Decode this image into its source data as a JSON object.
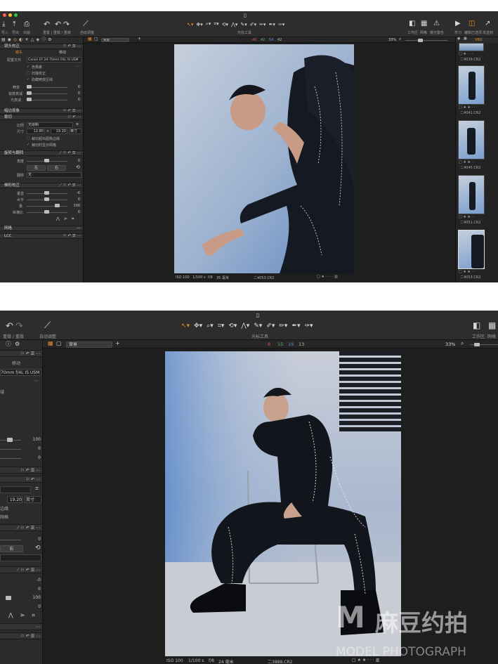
{
  "top": {
    "toolbar": {
      "import_label": "导入",
      "export_label": "导出",
      "output_label": "出版",
      "undo_redo_label": "重置 | 重做 / 重做",
      "auto_adjust_label": "自动调整",
      "cursor_tools_label": "光标工具",
      "layout_label": "工作区",
      "grid_label": "网格",
      "warning_label": "曝光警告",
      "learn_label": "学习",
      "edit_label": "编辑已选项",
      "send_label": "发送到"
    },
    "viewer_bar": {
      "layer_select": "背景",
      "counts": [
        "40",
        "42",
        "54",
        "42"
      ],
      "zoom": "33%"
    },
    "lens": {
      "header": "镜头校正",
      "tab_lens": "镜头",
      "tab_move": "移动",
      "profile_label": "配置文件",
      "profile_value": "Canon EF 24-70mm f/4L IS USM",
      "opt_chromatic": "色像差",
      "opt_purple": "扫描校正",
      "opt_hide": "隐藏畸变区域",
      "distortion_label": "畸变",
      "sharpness_label": "锐度衰减",
      "light_label": "光衰减",
      "distortion_value": "0",
      "sharpness_value": "0",
      "light_value": "0"
    },
    "vignette_header": "暗边现象",
    "crop": {
      "header": "裁切",
      "ratio_label": "比例",
      "ratio_value": "无限制",
      "size_label": "尺寸",
      "width": "12.80",
      "height": "19.20",
      "unit": "英寸",
      "opt_outside": "裁切超出图像边缘",
      "opt_grid": "裁切时显示网格"
    },
    "rotate": {
      "header": "旋转与翻转",
      "angle_label": "角度",
      "angle_value": "0",
      "left_btn": "左",
      "right_btn": "右",
      "flip_label": "翻转",
      "flip_value": "无"
    },
    "keystone": {
      "header": "梯形校正",
      "vertical_label": "垂直",
      "horizontal_label": "水平",
      "amount_label": "量",
      "aspect_label": "纵横比",
      "vertical_value": "-0",
      "horizontal_value": "0",
      "amount_value": "100",
      "aspect_value": "0"
    },
    "grid_header": "网格",
    "lcc_header": "LCC",
    "status": {
      "iso": "ISO 100",
      "shutter": "1/100 s",
      "aperture": "f/8",
      "focal": "35 毫米",
      "file": "二4053.CR2"
    },
    "browser": {
      "tab_label": "VBO",
      "thumbs": [
        {
          "file": "二4039.CR2"
        },
        {
          "file": "二4041.CR2"
        },
        {
          "file": "二4045.CR2"
        },
        {
          "file": "二4051.CR2"
        },
        {
          "file": "二4053.CR2"
        }
      ]
    }
  },
  "bottom": {
    "toolbar": {
      "undo_redo_label": "重做 / 重做",
      "auto_adjust_label": "自动调整",
      "cursor_tools_label": "光标工具",
      "layout_label": "工作区",
      "grid_label": "网格"
    },
    "viewer_bar": {
      "layer_select": "背景",
      "counts": [
        "8",
        "15",
        "19",
        "13"
      ],
      "zoom": "33%"
    },
    "panel": {
      "tab_move": "移动",
      "profile_value": "70mm f/4L IS USM",
      "rows": [
        {
          "label": "",
          "value": "100"
        },
        {
          "label": "",
          "value": "0"
        },
        {
          "label": "",
          "value": "0"
        }
      ],
      "section_label_a": "域",
      "crop_height": "19.20",
      "crop_unit": "英寸",
      "opt_edge": "边缘",
      "opt_grid": "网格",
      "angle_value": "0",
      "right_btn": "右",
      "keystone_values": [
        "-0",
        "0",
        "100",
        "0"
      ]
    },
    "status": {
      "iso": "ISO 100",
      "shutter": "1/100 s",
      "aperture": "f/8",
      "focal": "24 毫米",
      "file": "二3888.CR2"
    },
    "watermark": {
      "brand": "麻豆约拍",
      "sub": "MODEL PHOTOGRAPH"
    }
  },
  "colors": {
    "accent": "#e08a2c",
    "count_red": "#d9534f",
    "count_green": "#5cb85c",
    "count_blue": "#5b8bd6"
  }
}
